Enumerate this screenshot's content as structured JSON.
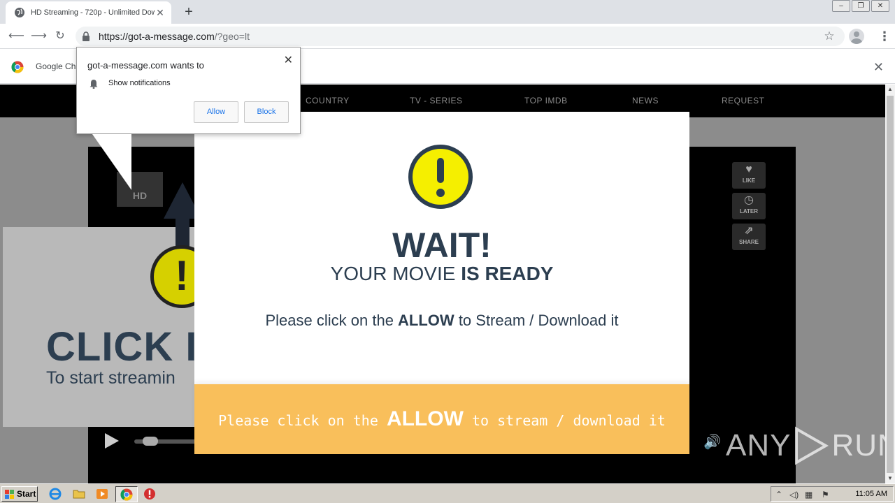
{
  "browser": {
    "tab_title": "HD Streaming - 720p - Unlimited Dow",
    "tab_close": "✕",
    "new_tab": "+",
    "url_host": "https://got-a-message.com",
    "url_path": "/?geo=lt",
    "infobar_text": "Google Ch",
    "win_min": "–",
    "win_restore": "❐",
    "win_close": "✕"
  },
  "prompt": {
    "heading": "got-a-message.com wants to",
    "permission": "Show notifications",
    "allow": "Allow",
    "block": "Block",
    "close": "✕"
  },
  "site": {
    "nav": [
      "COUNTRY",
      "TV - SERIES",
      "TOP IMDB",
      "NEWS",
      "REQUEST"
    ],
    "hd_label": "HD",
    "side_buttons": [
      {
        "icon": "♥",
        "label": "LIKE"
      },
      {
        "icon": "◷",
        "label": "LATER"
      },
      {
        "icon": "⇗",
        "label": "SHARE"
      }
    ],
    "bg_headline": "CLICK I",
    "bg_sub": "To start streamin"
  },
  "modal": {
    "wait": "WAIT!",
    "ready_pre": "YOUR MOVIE ",
    "ready_bold": "IS READY",
    "msg_pre": "Please click on the ",
    "msg_bold": "ALLOW",
    "msg_post": " to Stream / Download it",
    "footer_pre": "Please click on the ",
    "footer_bold": "ALLOW",
    "footer_post": " to stream / download it",
    "accent_color": "#f9bf5b",
    "alert_color": "#f5ef00"
  },
  "watermark": {
    "left": "ANY",
    "right": "RUN"
  },
  "taskbar": {
    "start": "Start",
    "clock": "11:05 AM"
  }
}
